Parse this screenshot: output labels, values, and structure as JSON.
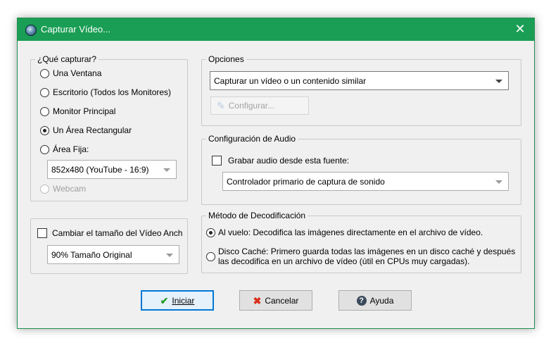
{
  "window": {
    "title": "Capturar Vídeo...",
    "close_glyph": "✕",
    "accent_color": "#1a9e55"
  },
  "capture_group": {
    "legend": "¿Qué capturar?",
    "options": [
      {
        "label": "Una Ventana",
        "selected": false,
        "enabled": true
      },
      {
        "label": "Escritorio (Todos los Monitores)",
        "selected": false,
        "enabled": true
      },
      {
        "label": "Monitor Principal",
        "selected": false,
        "enabled": true
      },
      {
        "label": "Un Área Rectangular",
        "selected": true,
        "enabled": true
      },
      {
        "label": "Área Fija:",
        "selected": false,
        "enabled": true
      },
      {
        "label": "Webcam",
        "selected": false,
        "enabled": false
      }
    ],
    "fixed_area_value": "852x480 (YouTube - 16:9)"
  },
  "resize_group": {
    "checkbox_label": "Cambiar el tamaño del Vídeo Anch",
    "checked": false,
    "size_value": "90% Tamaño Original"
  },
  "options_group": {
    "legend": "Opciones",
    "mode_value": "Capturar un vídeo o un contenido similar",
    "configure_label": "Configurar..."
  },
  "audio_group": {
    "legend": "Configuración de Audio",
    "checkbox_label": "Grabar audio desde esta fuente:",
    "checked": false,
    "source_value": "Controlador primario de captura de sonido"
  },
  "decode_group": {
    "legend": "Método de Decodificación",
    "option1": "Al vuelo: Decodifica las imágenes directamente en el archivo de vídeo.",
    "option2_line1": "Disco Caché: Primero guarda todas las imágenes en un disco caché y después",
    "option2_line2": "las decodifica en un archivo de vídeo (útil en CPUs muy cargadas).",
    "selected": 1
  },
  "buttons": {
    "start": {
      "label": "Iniciar",
      "icon": "check-icon",
      "color": "#2a9d2a"
    },
    "cancel": {
      "label": "Cancelar",
      "icon": "x-icon",
      "color": "#d8301c"
    },
    "help": {
      "label": "Ayuda",
      "icon": "help-icon",
      "color": "#3a4a5c"
    }
  }
}
